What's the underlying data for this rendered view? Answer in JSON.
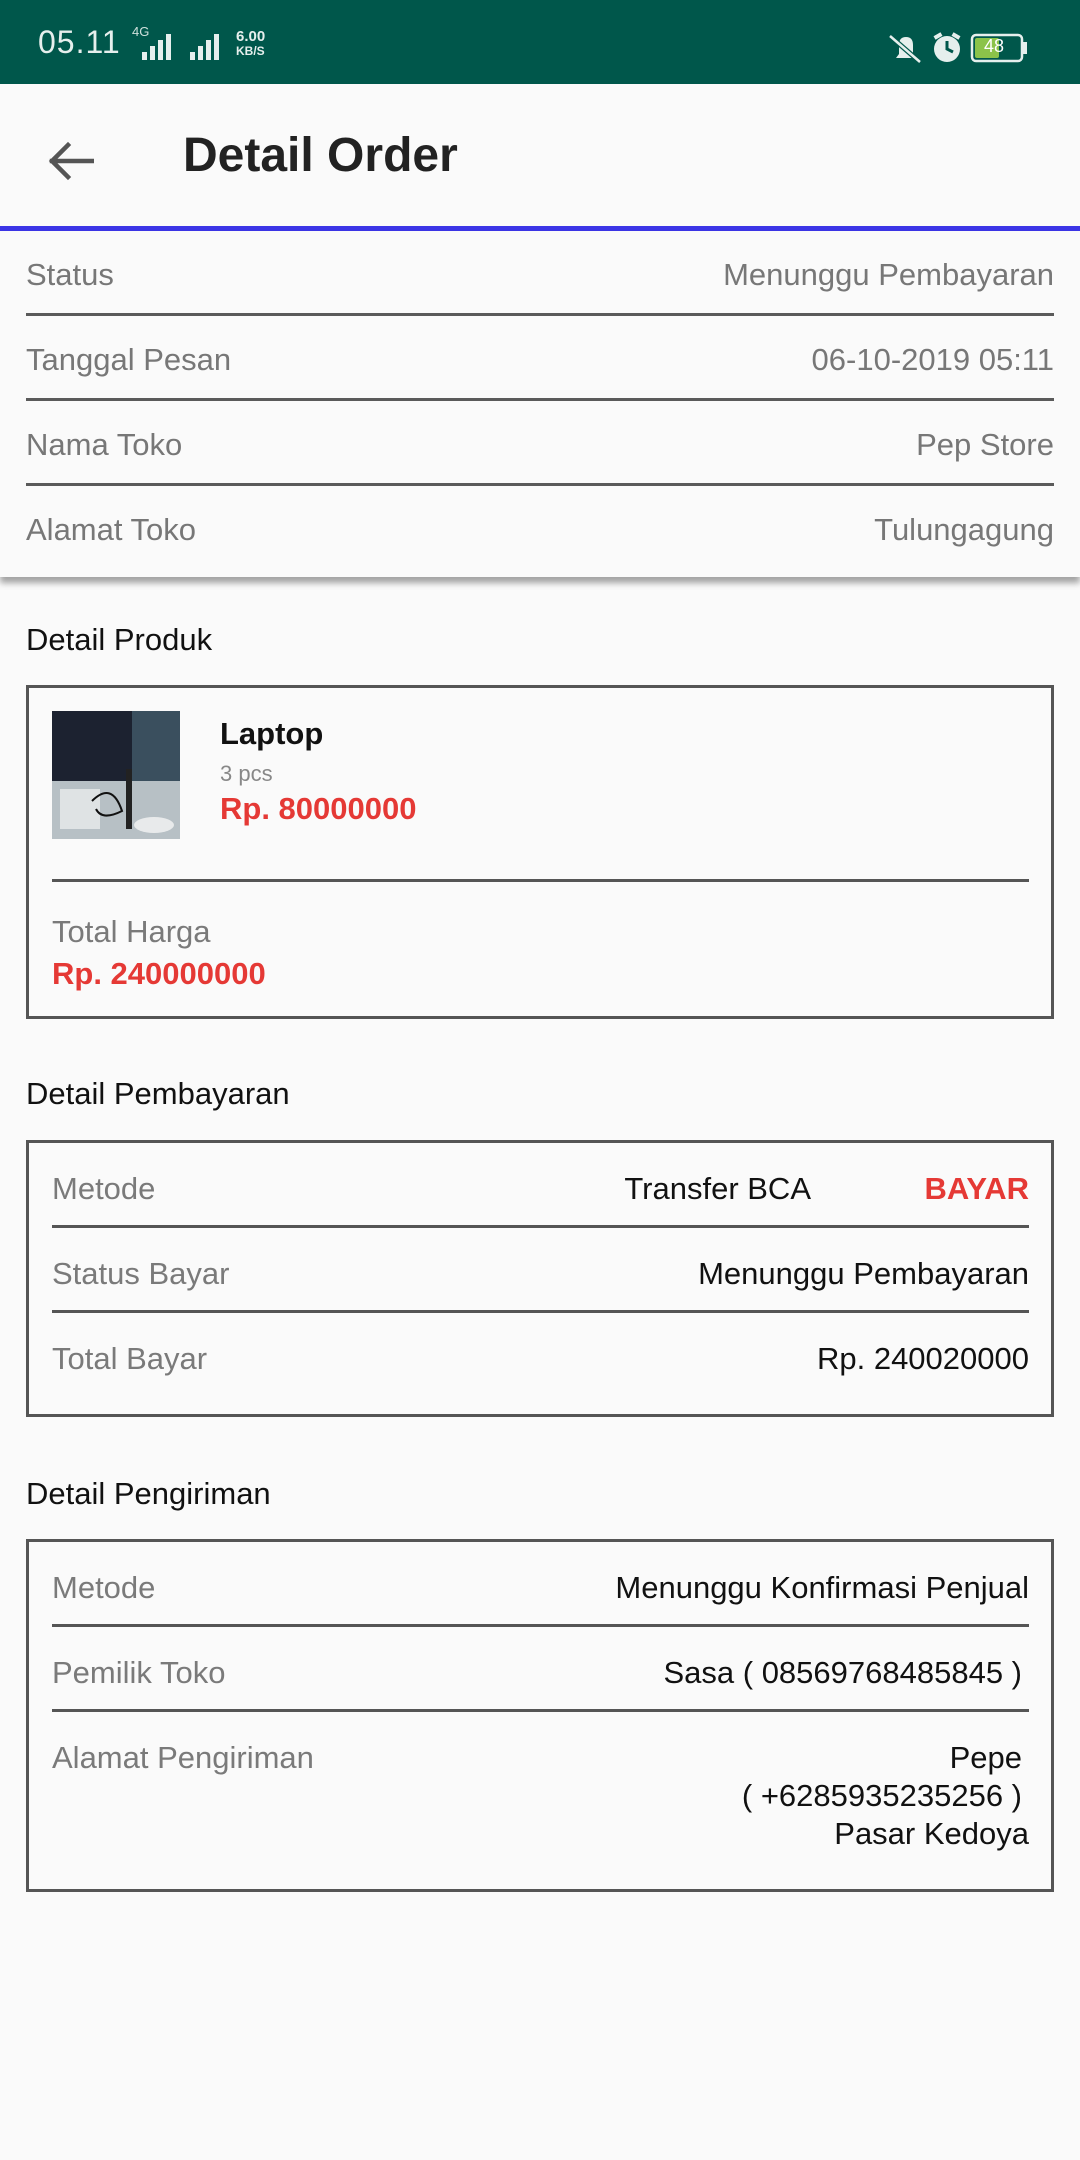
{
  "status_bar": {
    "time": "05.11",
    "network": "4G",
    "speed": "6.00",
    "speed_unit": "KB/S",
    "battery": "48"
  },
  "header": {
    "title": "Detail Order"
  },
  "order_info": [
    {
      "label": "Status",
      "value": "Menunggu Pembayaran"
    },
    {
      "label": "Tanggal Pesan",
      "value": "06-10-2019 05:11"
    },
    {
      "label": "Nama Toko",
      "value": "Pep Store"
    },
    {
      "label": "Alamat Toko",
      "value": "Tulungagung"
    }
  ],
  "product_section": {
    "title": "Detail Produk",
    "product": {
      "name": "Laptop",
      "qty": "3 pcs",
      "price": "Rp. 80000000"
    },
    "total_label": "Total Harga",
    "total_value": "Rp. 240000000"
  },
  "payment_section": {
    "title": "Detail Pembayaran",
    "rows": [
      {
        "label": "Metode",
        "value": "Transfer BCA"
      },
      {
        "label": "Status Bayar",
        "value": "Menunggu Pembayaran"
      },
      {
        "label": "Total Bayar",
        "value": "Rp. 240020000"
      }
    ],
    "pay_button": "BAYAR"
  },
  "shipping_section": {
    "title": "Detail Pengiriman",
    "rows": [
      {
        "label": "Metode",
        "value": "Menunggu Konfirmasi Penjual"
      },
      {
        "label": "Pemilik Toko",
        "value": "Sasa ( 08569768485845 )"
      }
    ],
    "address_label": "Alamat Pengiriman",
    "address_name": "Pepe",
    "address_phone": "( +6285935235256 )",
    "address_place": "Pasar Kedoya"
  },
  "colors": {
    "status_bar": "#00574b",
    "accent_line": "#3b35e6",
    "price_red": "#e53935"
  }
}
